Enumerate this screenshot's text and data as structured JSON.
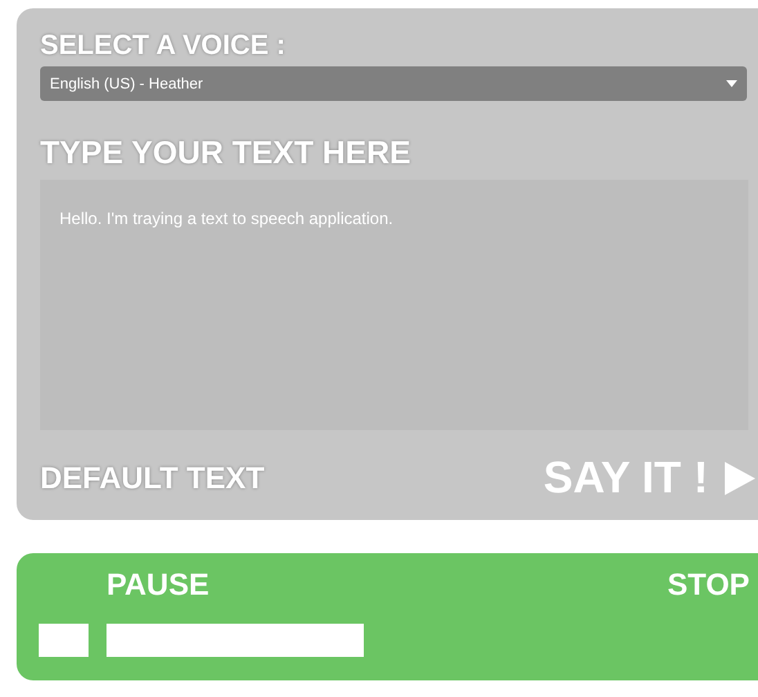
{
  "voice": {
    "label": "SELECT A VOICE :",
    "value": "English (US) - Heather"
  },
  "text_input": {
    "label": "TYPE YOUR TEXT HERE",
    "value": "Hello. I'm traying a text to speech application."
  },
  "default_text": "DEFAULT TEXT",
  "say_button": "SAY IT !",
  "player": {
    "pause": "PAUSE",
    "stop": "STOP"
  }
}
